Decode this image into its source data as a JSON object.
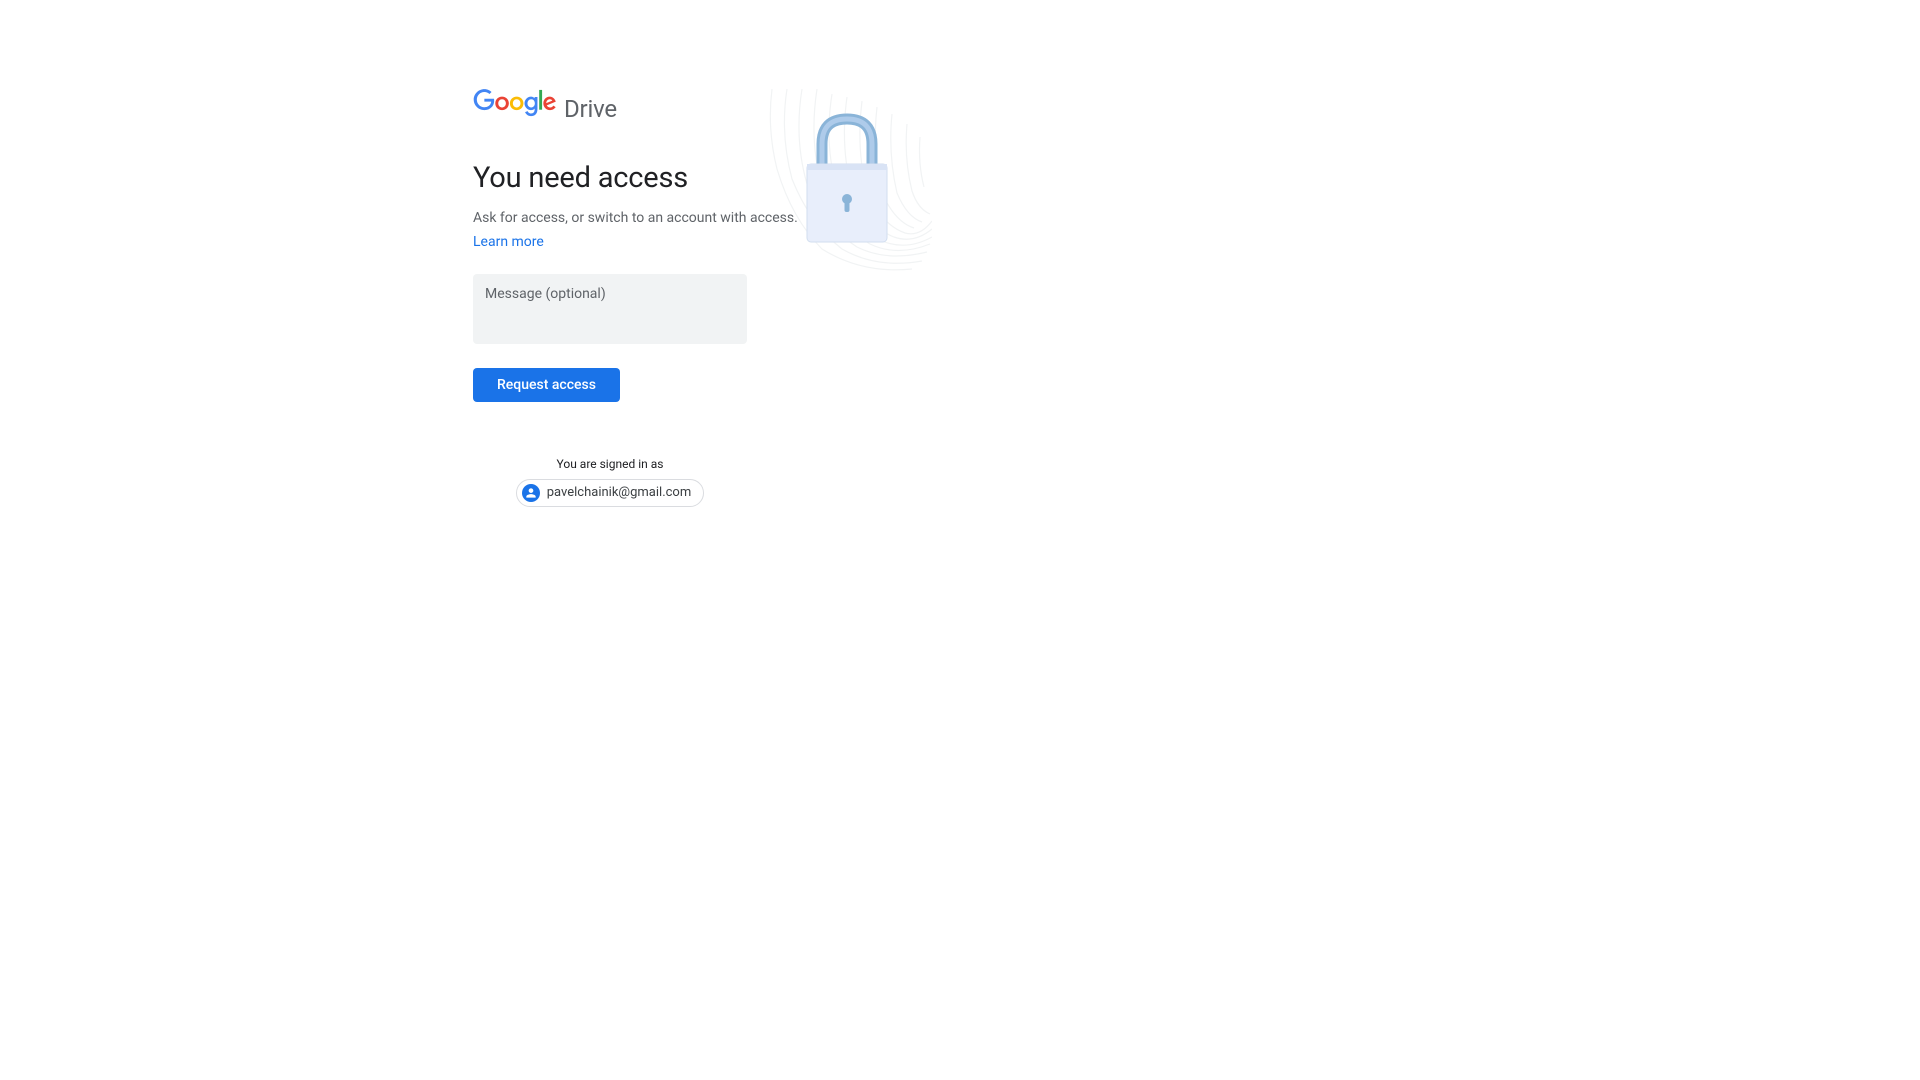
{
  "logo": {
    "drive_text": "Drive"
  },
  "heading": "You need access",
  "subtext": "Ask for access, or switch to an account with access.",
  "learn_more": "Learn more",
  "message_placeholder": "Message (optional)",
  "request_button": "Request access",
  "signed_in_label": "You are signed in as",
  "account_email": "pavelchainik@gmail.com"
}
